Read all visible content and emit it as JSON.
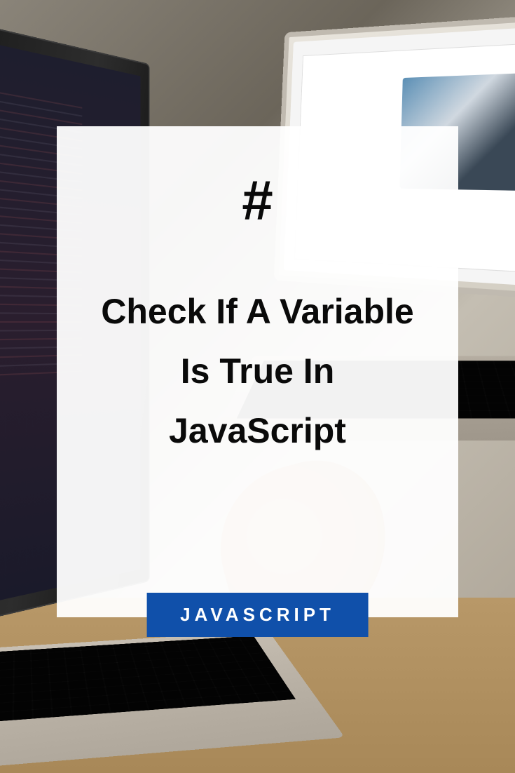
{
  "card": {
    "hash_symbol": "#",
    "title": "Check If A Variable Is True In JavaScript",
    "badge_label": "JAVASCRIPT"
  },
  "colors": {
    "badge_bg": "#1050aa",
    "badge_text": "#ffffff",
    "card_bg": "rgba(255, 255, 255, 0.95)",
    "text_color": "#0a0a0a"
  }
}
